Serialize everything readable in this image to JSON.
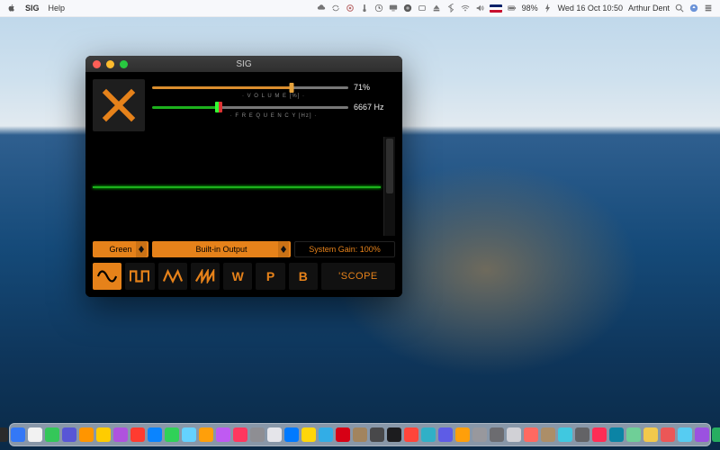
{
  "menubar": {
    "app_name": "SIG",
    "menus": [
      "Help"
    ],
    "battery_pct": "98%",
    "clock": "Wed 16 Oct  10:50",
    "user": "Arthur Dent",
    "locale_flag": "GB"
  },
  "window": {
    "title": "SIG",
    "big_icon": "mute-x-icon",
    "volume": {
      "value_pct": 71,
      "display": "71%",
      "label": "· V O L U M E  [%] ·"
    },
    "frequency": {
      "value_hz": 6667,
      "display": "6667 Hz",
      "label": "· F R E Q U E N C Y  [Hz] ·"
    },
    "color_dropdown": {
      "selected": "Green"
    },
    "output_dropdown": {
      "selected": "Built-in Output"
    },
    "system_gain": {
      "label": "System Gain: 100%",
      "value_pct": 100
    },
    "waveforms": [
      {
        "id": "sine",
        "glyph": "sine-icon",
        "selected": true
      },
      {
        "id": "square",
        "glyph": "square-icon",
        "selected": false
      },
      {
        "id": "triangle",
        "glyph": "triangle-icon",
        "selected": false
      },
      {
        "id": "sawtooth",
        "glyph": "sawtooth-icon",
        "selected": false
      },
      {
        "id": "white",
        "glyph": "W",
        "selected": false
      },
      {
        "id": "pink",
        "glyph": "P",
        "selected": false
      },
      {
        "id": "brown",
        "glyph": "B",
        "selected": false
      }
    ],
    "scope_button": "'SCOPE"
  },
  "colors": {
    "accent": "#e6821a",
    "trace": "#1db11d",
    "panel": "#000000"
  }
}
